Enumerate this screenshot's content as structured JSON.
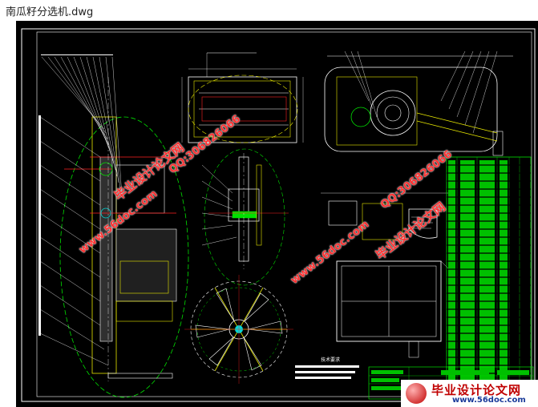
{
  "window": {
    "title": "南瓜籽分选机.dwg"
  },
  "watermarks": [
    {
      "text": "毕业设计论文网",
      "style": "a"
    },
    {
      "text": "QQ:306826066",
      "style": "b"
    },
    {
      "text": "www.56doc.com",
      "style": "b"
    },
    {
      "text": "毕业设计论文网",
      "style": "a"
    },
    {
      "text": "QQ:306826066",
      "style": "b"
    },
    {
      "text": "www.56doc.com",
      "style": "b"
    }
  ],
  "drawing": {
    "tech_requirements_title": "技术要求",
    "background": "#000000",
    "line_yellow": "#e8e800",
    "line_white": "#ffffff",
    "line_green": "#00e000",
    "line_red": "#ff2020",
    "line_cyan": "#00d8d8"
  },
  "logo": {
    "name": "毕业设计论文网",
    "url": "www.56doc.com"
  }
}
